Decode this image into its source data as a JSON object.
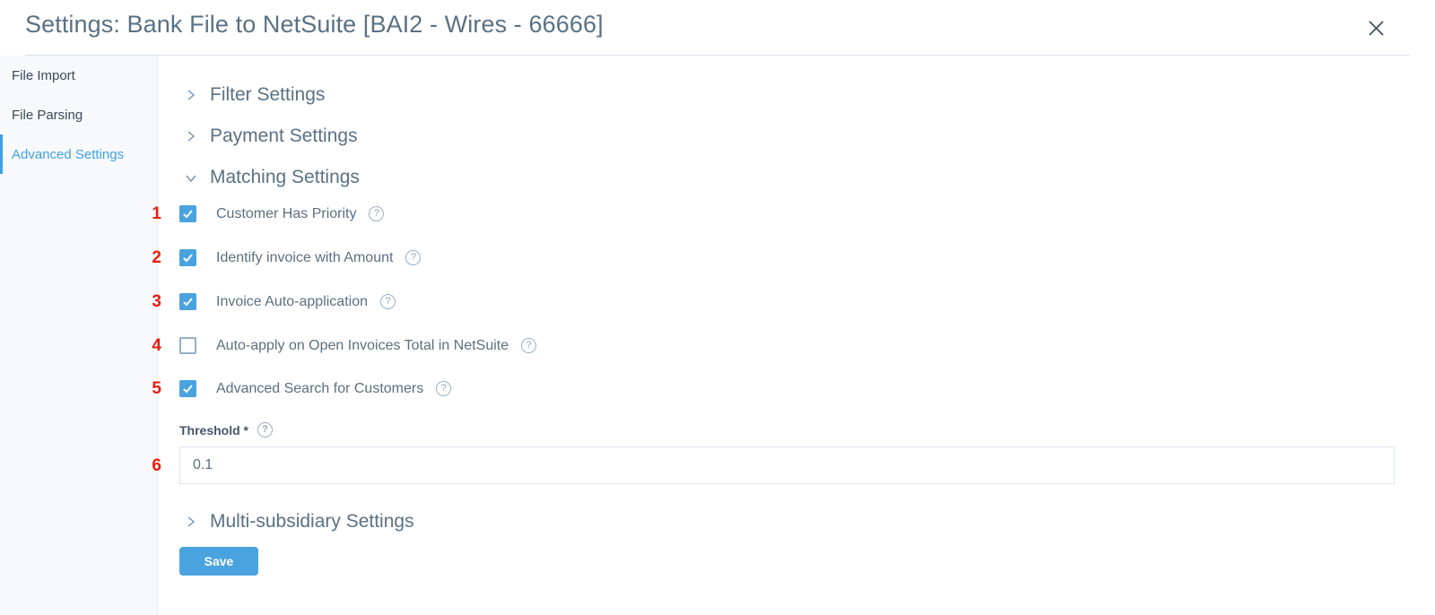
{
  "header": {
    "title": "Settings: Bank File to NetSuite [BAI2 - Wires - 66666]",
    "close_icon": "close-icon"
  },
  "sidebar": {
    "items": [
      {
        "label": "File Import",
        "active": false
      },
      {
        "label": "File Parsing",
        "active": false
      },
      {
        "label": "Advanced Settings",
        "active": true
      }
    ]
  },
  "main": {
    "sections": [
      {
        "label": "Filter Settings",
        "expanded": false,
        "icon": "chevron-right-icon"
      },
      {
        "label": "Payment Settings",
        "expanded": false,
        "icon": "chevron-right-icon"
      },
      {
        "label": "Matching Settings",
        "expanded": true,
        "icon": "chevron-down-icon"
      },
      {
        "label": "Multi-subsidiary Settings",
        "expanded": false,
        "icon": "chevron-right-icon"
      }
    ],
    "matching_settings": {
      "checkboxes": [
        {
          "annotation": "1",
          "label": "Customer Has Priority",
          "checked": true,
          "help_icon": "help-icon"
        },
        {
          "annotation": "2",
          "label": "Identify invoice with Amount",
          "checked": true,
          "help_icon": "help-icon"
        },
        {
          "annotation": "3",
          "label": "Invoice Auto-application",
          "checked": true,
          "help_icon": "help-icon"
        },
        {
          "annotation": "4",
          "label": "Auto-apply on Open Invoices Total in NetSuite",
          "checked": false,
          "help_icon": "help-icon"
        },
        {
          "annotation": "5",
          "label": "Advanced Search for Customers",
          "checked": true,
          "help_icon": "help-icon"
        }
      ],
      "threshold": {
        "annotation": "6",
        "label": "Threshold *",
        "value": "0.1",
        "placeholder": "",
        "help_icon": "help-icon"
      }
    },
    "save_label": "Save"
  },
  "colors": {
    "accent": "#4aa3de",
    "annotation": "#ee1b0c",
    "text": "#5c6f80",
    "heading": "#5a7184"
  }
}
